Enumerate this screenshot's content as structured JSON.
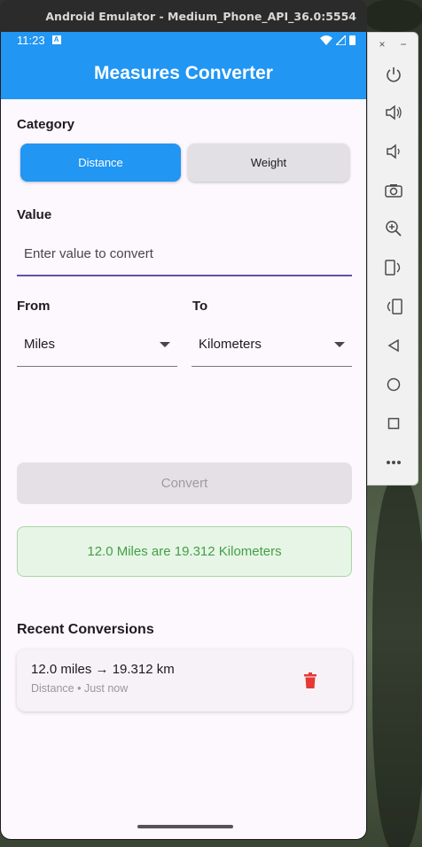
{
  "emulator": {
    "title": "Android Emulator - Medium_Phone_API_36.0:5554",
    "close_label": "×",
    "minimize_label": "−",
    "toolbar_icons": [
      "power-icon",
      "volume-up-icon",
      "volume-down-icon",
      "camera-icon",
      "zoom-icon",
      "rotate-left-icon",
      "rotate-right-icon",
      "back-icon",
      "home-icon",
      "overview-icon",
      "more-icon"
    ]
  },
  "status_bar": {
    "time": "11:23"
  },
  "app": {
    "title": "Measures Converter",
    "accent": "#2196f3"
  },
  "category": {
    "label": "Category",
    "options": [
      {
        "label": "Distance",
        "selected": true
      },
      {
        "label": "Weight",
        "selected": false
      }
    ]
  },
  "value": {
    "label": "Value",
    "placeholder": "Enter value to convert"
  },
  "from": {
    "label": "From",
    "selected": "Miles"
  },
  "to": {
    "label": "To",
    "selected": "Kilometers"
  },
  "convert": {
    "label": "Convert"
  },
  "result": {
    "text": "12.0 Miles are 19.312 Kilometers",
    "color": "#43a047"
  },
  "recent": {
    "title": "Recent Conversions",
    "items": [
      {
        "main": "12.0 miles → 19.312 km",
        "sub": "Distance • Just now"
      }
    ]
  }
}
